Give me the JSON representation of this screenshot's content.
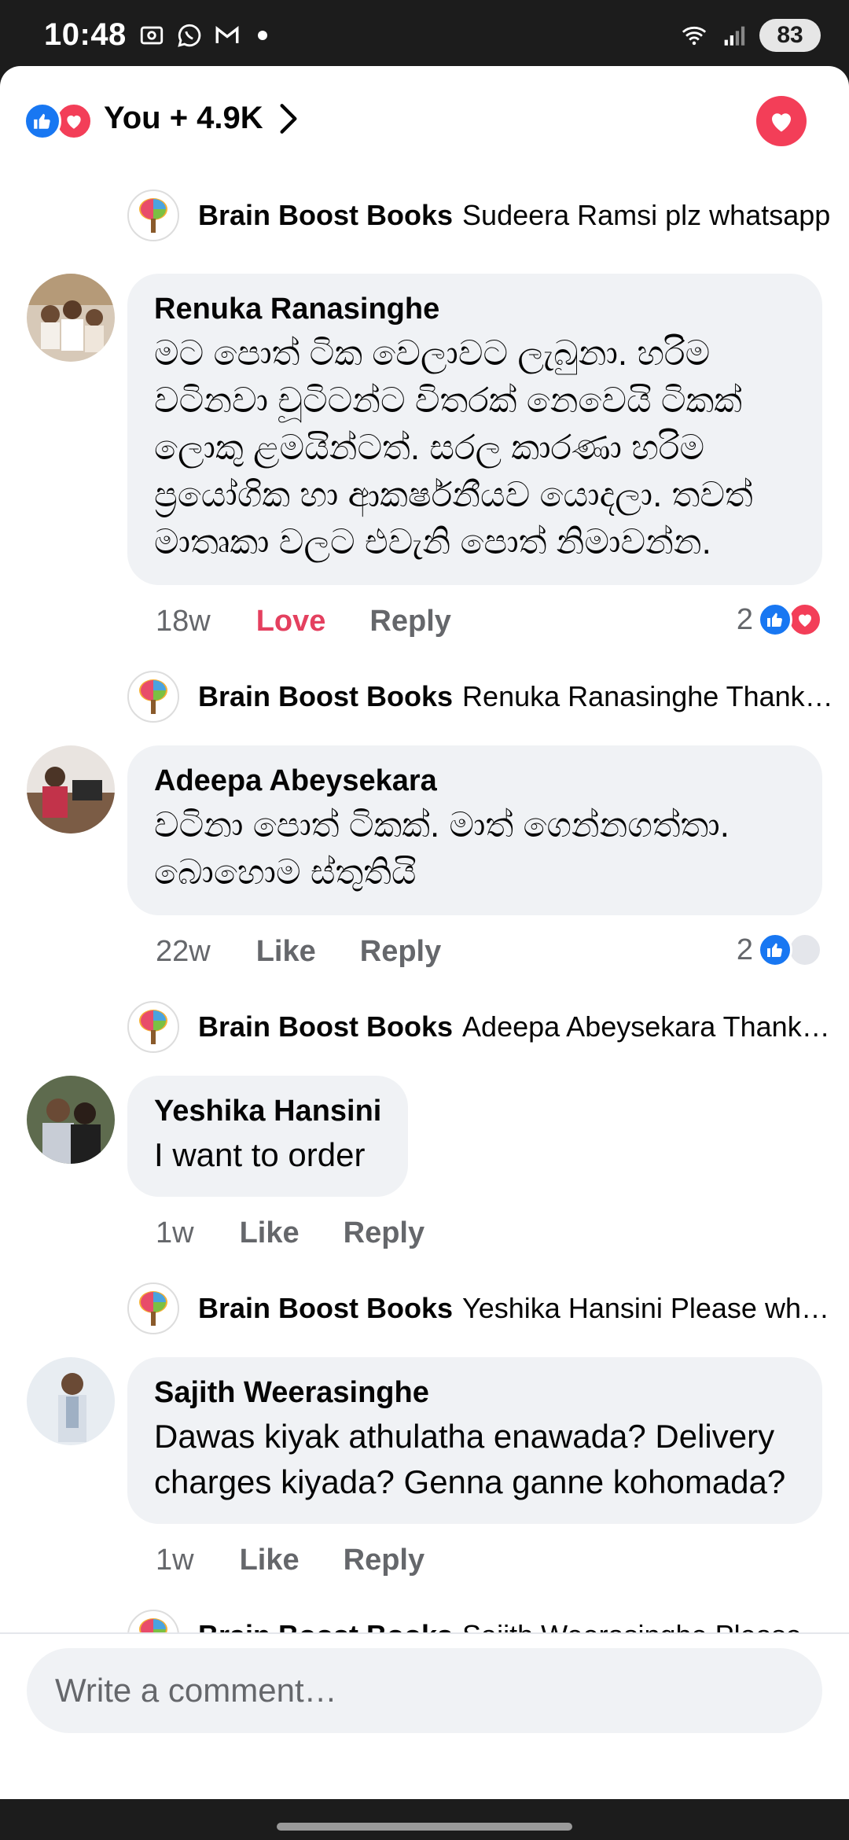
{
  "status_bar": {
    "time": "10:48",
    "battery": "83",
    "left_icons": [
      "screenshot-icon",
      "whatsapp-icon",
      "gmail-icon",
      "dot-icon"
    ],
    "right_icons": [
      "wifi-icon",
      "signal-icon",
      "battery-icon"
    ]
  },
  "header": {
    "reactions_summary": "You + 4.9K",
    "reaction_icons": [
      "like-icon",
      "love-icon"
    ]
  },
  "comments": [
    {
      "type": "reply",
      "author": "Brain Boost Books",
      "preview": "Sudeera Ramsi plz whatsapp"
    },
    {
      "type": "comment",
      "author": "Renuka Ranasinghe",
      "text": "මට පොත් ටික වෙලාවට ලැබුනා. හරිම වටිනවා චූටිටන්ට විතරක් නෙවෙයි ටිකක් ලොකු ළමයින්ටත්. සරල කාරණා හරිම ප්‍රයෝගික හා ආකර්ෂනීයව යොදලා. තවත් මාතෘකා වලට එවැනි පොත් නිමාවන්න.",
      "time": "18w",
      "action_react": "Love",
      "action_reply": "Reply",
      "reaction_count": "2",
      "reactions": [
        "like",
        "love"
      ]
    },
    {
      "type": "reply",
      "author": "Brain Boost Books",
      "preview": "Renuka Ranasinghe Thank you"
    },
    {
      "type": "comment",
      "author": "Adeepa Abeysekara",
      "text": "වටිනා පොත් ටිකක්. මාත් ගෙන්නගත්තා. බොහොම ස්තුතියි",
      "time": "22w",
      "action_react": "Like",
      "action_reply": "Reply",
      "reaction_count": "2",
      "reactions": [
        "like",
        "grey"
      ]
    },
    {
      "type": "reply",
      "author": "Brain Boost Books",
      "preview": "Adeepa Abeysekara Thank you"
    },
    {
      "type": "comment",
      "author": "Yeshika Hansini",
      "text": "I want to order",
      "time": "1w",
      "action_react": "Like",
      "action_reply": "Reply"
    },
    {
      "type": "reply",
      "author": "Brain Boost Books",
      "preview": "Yeshika Hansini Please whatsapp"
    },
    {
      "type": "comment",
      "author": "Sajith Weerasinghe",
      "text": "Dawas kiyak athulatha enawada? Delivery charges kiyada? Genna ganne kohomada?",
      "time": "1w",
      "action_react": "Like",
      "action_reply": "Reply"
    },
    {
      "type": "reply",
      "author": "Brain Boost Books",
      "preview": "Sajith Weerasinghe Please whatsapp"
    }
  ],
  "composer": {
    "placeholder": "Write a comment…"
  },
  "colors": {
    "like_blue": "#1877f2",
    "love_red": "#f33e58",
    "bubble_grey": "#f0f2f5",
    "meta_grey": "#65676b"
  }
}
